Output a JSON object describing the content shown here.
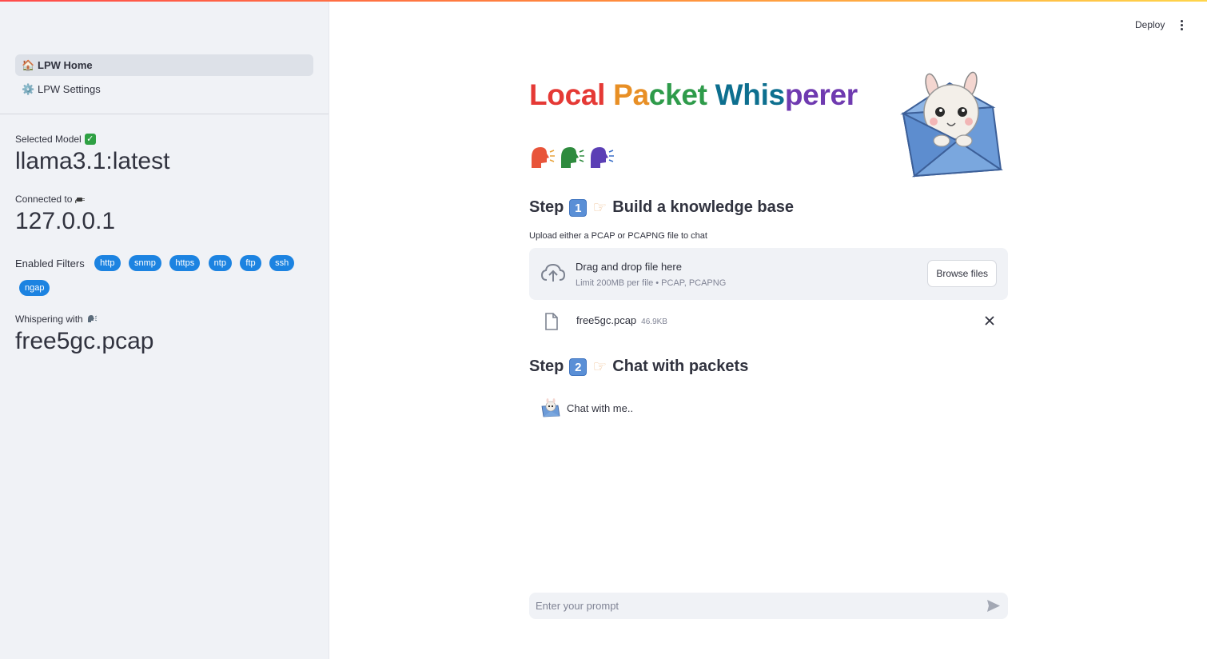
{
  "header": {
    "deploy_label": "Deploy"
  },
  "sidebar": {
    "nav": [
      {
        "emoji": "🏠",
        "label": "LPW Home",
        "active": true
      },
      {
        "emoji": "⚙️",
        "label": "LPW Settings",
        "active": false
      }
    ],
    "model": {
      "label": "Selected Model",
      "value": "llama3.1:latest"
    },
    "connection": {
      "label": "Connected to",
      "value": "127.0.0.1"
    },
    "filters": {
      "label": "Enabled Filters",
      "items": [
        "http",
        "snmp",
        "https",
        "ntp",
        "ftp",
        "ssh",
        "ngap"
      ]
    },
    "whisper": {
      "label": "Whispering with",
      "value": "free5gc.pcap"
    }
  },
  "main": {
    "title": {
      "word1": "Local",
      "word2_a": "Pa",
      "word2_b": "cket",
      "word3_a": "Whis",
      "word3_b": "perer"
    },
    "step1": {
      "prefix": "Step",
      "number": "1",
      "text": "Build a knowledge base"
    },
    "upload": {
      "label": "Upload either a PCAP or PCAPNG file to chat",
      "drop_title": "Drag and drop file here",
      "drop_sub": "Limit 200MB per file • PCAP, PCAPNG",
      "browse_label": "Browse files"
    },
    "file": {
      "name": "free5gc.pcap",
      "size": "46.9KB"
    },
    "step2": {
      "prefix": "Step",
      "number": "2",
      "text": "Chat with packets"
    },
    "chat": {
      "message": "Chat with me.."
    },
    "prompt": {
      "placeholder": "Enter your prompt"
    }
  },
  "colors": {
    "accent": "#1c83e1",
    "sidebar_bg": "#f0f2f6",
    "text": "#31333f"
  },
  "icons": [
    "house-icon",
    "gear-icon",
    "check-icon",
    "plug-icon",
    "speaking-head-icon",
    "cloud-upload-icon",
    "file-icon",
    "close-icon",
    "send-icon",
    "kebab-menu-icon",
    "llama-mascot"
  ]
}
